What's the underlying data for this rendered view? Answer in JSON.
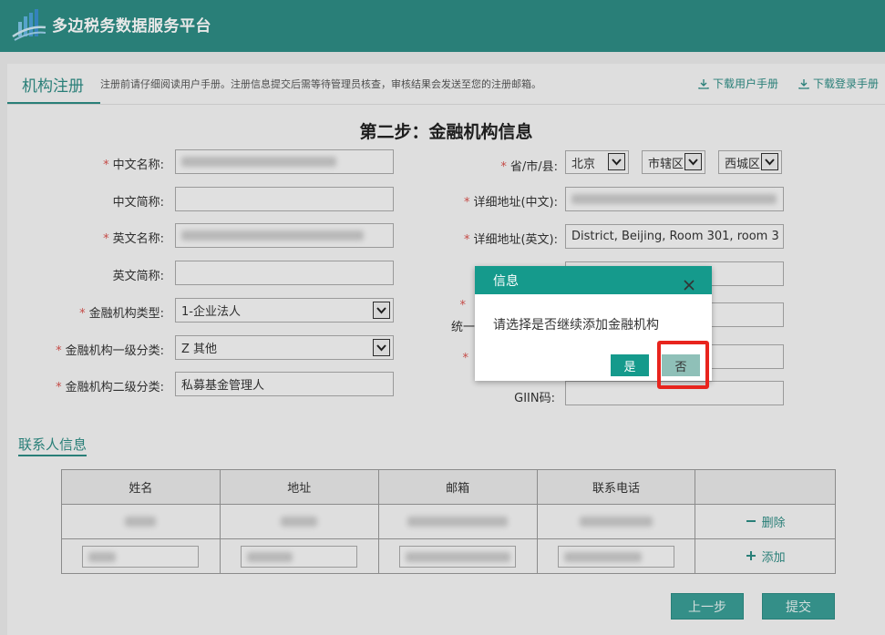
{
  "app": {
    "title": "多边税务数据服务平台"
  },
  "tab": {
    "title": "机构注册",
    "notice": "注册前请仔细阅读用户手册。注册信息提交后需等待管理员核查，审核结果会发送至您的注册邮箱。",
    "downloads": [
      "下载用户手册",
      "下载登录手册"
    ]
  },
  "form": {
    "step_title": "第二步：金融机构信息",
    "left": [
      {
        "label": "中文名称:",
        "required": true,
        "value": ""
      },
      {
        "label": "中文简称:",
        "required": false,
        "value": ""
      },
      {
        "label": "英文名称:",
        "required": true,
        "value": ""
      },
      {
        "label": "英文简称:",
        "required": false,
        "value": ""
      },
      {
        "label": "金融机构类型:",
        "required": true,
        "value": "1-企业法人"
      },
      {
        "label": "金融机构一级分类:",
        "required": true,
        "value": "Z 其他"
      },
      {
        "label": "金融机构二级分类:",
        "required": true,
        "value": "私募基金管理人"
      }
    ],
    "right": {
      "region_label": "省/市/县:",
      "province": "北京",
      "city": "市辖区",
      "district": "西城区",
      "address_cn_label": "详细地址(中文):",
      "address_en_label": "详细地址(英文):",
      "address_en_value": "District, Beijing, Room 301, room 3",
      "uscc_label_part": "统一",
      "giin_label": "GIIN码:"
    }
  },
  "contacts": {
    "section_title": "联系人信息",
    "headers": [
      "姓名",
      "地址",
      "邮箱",
      "联系电话",
      ""
    ],
    "delete_label": "删除",
    "add_label": "添加"
  },
  "buttons": {
    "prev": "上一步",
    "submit": "提交"
  },
  "dialog": {
    "title": "信息",
    "message": "请选择是否继续添加金融机构",
    "yes": "是",
    "no": "否"
  },
  "colors": {
    "brand": "#2e8c84",
    "dialog_header": "#159a8c",
    "highlight": "#e8241d"
  }
}
